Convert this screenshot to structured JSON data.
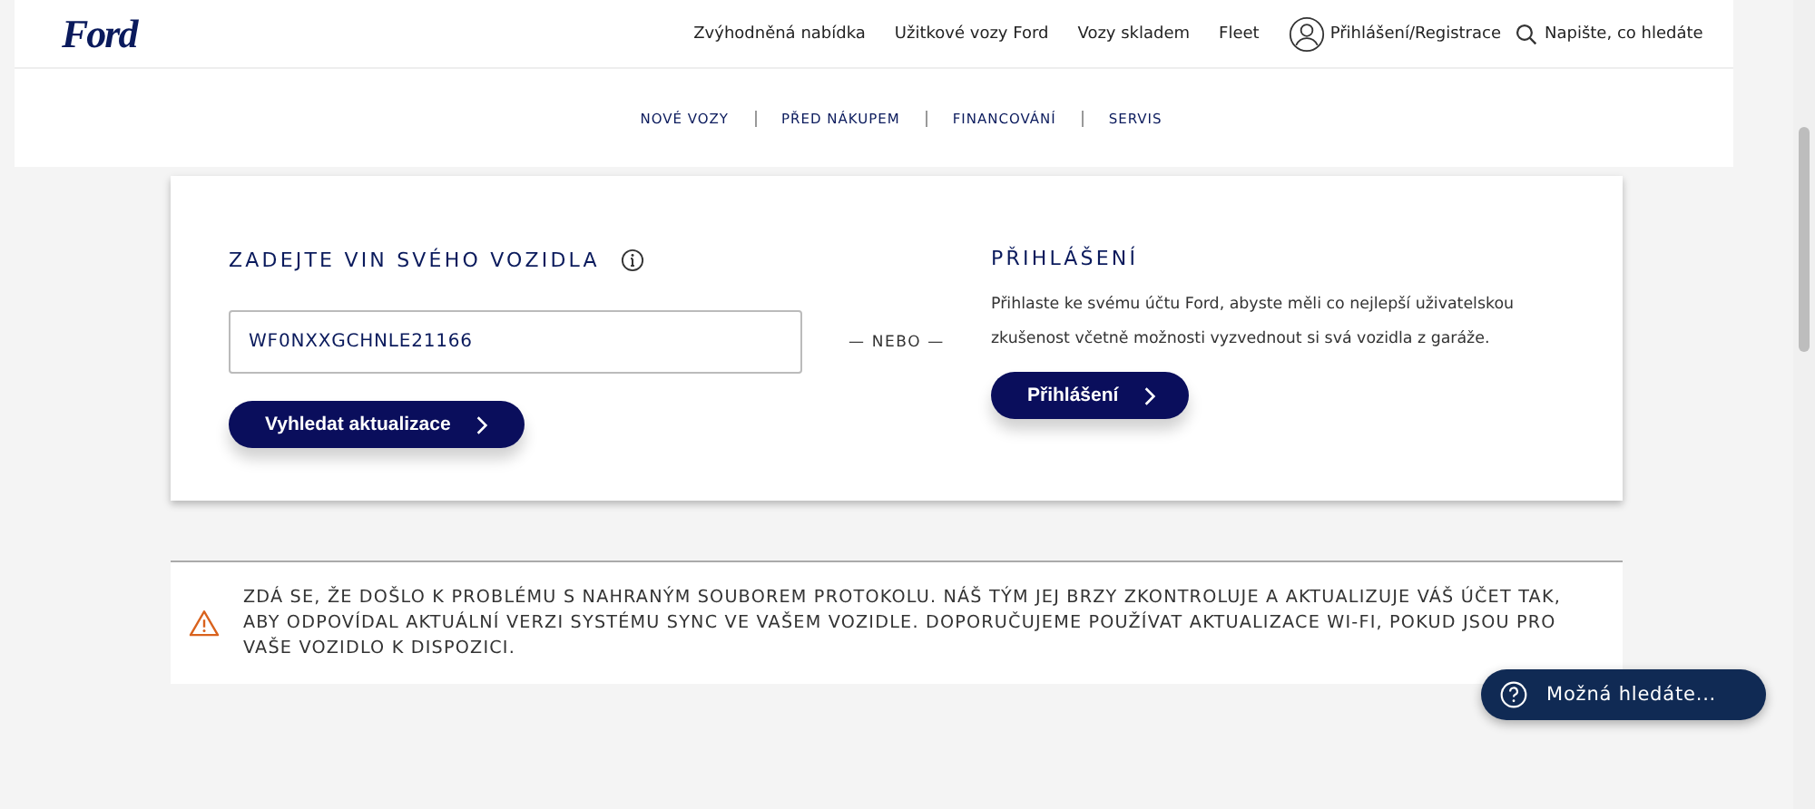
{
  "header": {
    "logo": "Ford",
    "links": [
      "Zvýhodněná nabídka",
      "Užitkové vozy Ford",
      "Vozy skladem",
      "Fleet"
    ],
    "account": "Přihlášení/Registrace",
    "search": {
      "placeholder": "Napište, co hledáte"
    }
  },
  "subnav": [
    "NOVÉ VOZY",
    "PŘED NÁKUPEM",
    "FINANCOVÁNÍ",
    "SERVIS"
  ],
  "vin": {
    "title": "ZADEJTE VIN SVÉHO VOZIDLA",
    "value": "WF0NXXGCHNLE21166",
    "button": "Vyhledat aktualizace"
  },
  "separator": "— NEBO —",
  "login": {
    "title": "PŘIHLÁŠENÍ",
    "text": "Přihlaste ke svému účtu Ford, abyste měli co nejlepší uživatelskou zkušenost včetně možnosti vyzvednout si svá vozidla z garáže.",
    "button": "Přihlášení"
  },
  "alert": {
    "text": "ZDÁ SE, ŽE DOŠLO K PROBLÉMU S NAHRANÝM SOUBOREM PROTOKOLU. NÁŠ TÝM JEJ BRZY ZKONTROLUJE A AKTUALIZUJE VÁŠ ÚČET TAK, ABY ODPOVÍDAL AKTUÁLNÍ VERZI SYSTÉMU SYNC VE VAŠEM VOZIDLE. DOPORUČUJEME POUŽÍVAT AKTUALIZACE WI-FI, POKUD JSOU PRO VAŠE VOZIDLO K DISPOZICI."
  },
  "help_button": "Možná hledáte..."
}
